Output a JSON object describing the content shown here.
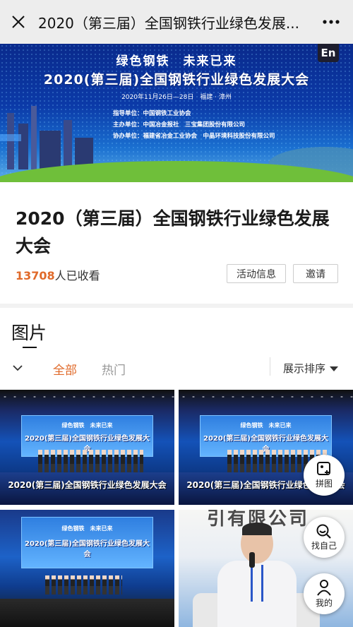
{
  "topbar": {
    "title": "2020（第三届）全国钢铁行业绿色发展...",
    "close_icon": "close-icon",
    "more_icon": "more-icon"
  },
  "banner": {
    "slogan": "绿色钢铁　未来已来",
    "headline": "2020(第三届)全国钢铁行业绿色发展大会",
    "date": "2020年11月26日—28日　福建 · 漳州",
    "org_lines": [
      "指导单位：中国钢铁工业协会",
      "主办单位：中国冶金报社　三宝集团股份有限公司",
      "协办单位：福建省冶金工业协会　中晶环境科技股份有限公司"
    ],
    "lang_badge": "En"
  },
  "info": {
    "title": "2020（第三届）全国钢铁行业绿色发展大会",
    "view_count": "13708",
    "view_suffix": "人已收看",
    "activity_button": "活动信息",
    "invite_button": "邀请"
  },
  "photos_section": {
    "title": "图片",
    "tabs": [
      "全部",
      "热门"
    ],
    "active_tab": "全部",
    "sort_label": "展示排序"
  },
  "photos": [
    {
      "screen_small": "绿色钢铁　未来已来",
      "screen_title": "2020(第三届)全国钢铁行业绿色发展大会",
      "caption": "2020(第三届)全国钢铁行业绿色发展大会"
    },
    {
      "screen_small": "绿色钢铁　未来已来",
      "screen_title": "2020(第三届)全国钢铁行业绿色发展大会",
      "caption": "2020(第三届)全国钢铁行业绿色发展大会"
    },
    {
      "screen_small": "绿色钢铁　未来已来",
      "screen_title": "2020(第三届)全国钢铁行业绿色发展大会"
    },
    {
      "banner_text": "引有限公司"
    }
  ],
  "fabs": {
    "collage": "拼图",
    "find_me": "找自己",
    "mine": "我的"
  },
  "colors": {
    "accent": "#e06a2a",
    "topbar_bg": "#ededed",
    "muted_text": "#999999"
  }
}
